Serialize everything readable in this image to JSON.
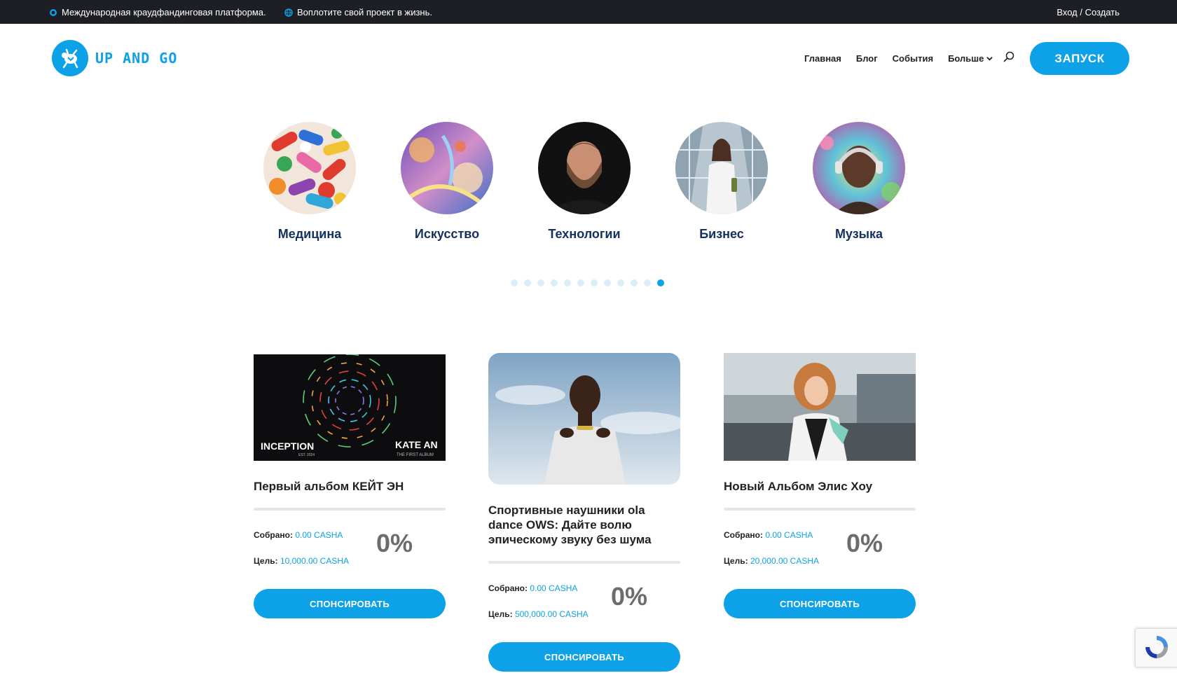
{
  "topbar": {
    "tagline": "Международная краудфандинговая платформа.",
    "slogan": "Воплотите свой проект в жизнь.",
    "auth": "Вход / Создать"
  },
  "header": {
    "logo_text": "UP AND GO",
    "nav": [
      "Главная",
      "Блог",
      "События",
      "Больше"
    ],
    "launch_label": "ЗАПУСК"
  },
  "categories": [
    {
      "label": "Медицина",
      "image": "pills"
    },
    {
      "label": "Искусство",
      "image": "fantasy-painting"
    },
    {
      "label": "Технологии",
      "image": "bearded-man"
    },
    {
      "label": "Бизнес",
      "image": "businesswoman"
    },
    {
      "label": "Музыка",
      "image": "woman-headphones"
    }
  ],
  "carousel": {
    "dot_count": 12,
    "active_index": 11
  },
  "projects": [
    {
      "title": "Первый альбом КЕЙТ ЭН",
      "cover_text_left": "INCEPTION",
      "cover_sub_left": "EST. 2024",
      "cover_text_right": "KATE AN",
      "cover_sub_right": "THE FIRST ALBUM",
      "raised_label": "Собрано:",
      "raised": "0.00 CASHA",
      "goal_label": "Цель:",
      "goal": "10,000.00 CASHA",
      "percent": "0%",
      "percent_value": 0,
      "button": "СПОНСИРОВАТЬ"
    },
    {
      "title": "Спортивные наушники ola dance OWS: Дайте волю эпическому звуку без шума",
      "raised_label": "Собрано:",
      "raised": "0.00 CASHA",
      "goal_label": "Цель:",
      "goal": "500,000.00 CASHA",
      "percent": "0%",
      "percent_value": 0,
      "button": "СПОНСИРОВАТЬ"
    },
    {
      "title": "Новый Альбом Элис Хоу",
      "raised_label": "Собрано:",
      "raised": "0.00 CASHA",
      "goal_label": "Цель:",
      "goal": "20,000.00 CASHA",
      "percent": "0%",
      "percent_value": 0,
      "button": "СПОНСИРОВАТЬ"
    }
  ],
  "colors": {
    "accent": "#0da1e8",
    "topbar": "#1d1f24",
    "heading": "#14305e"
  }
}
